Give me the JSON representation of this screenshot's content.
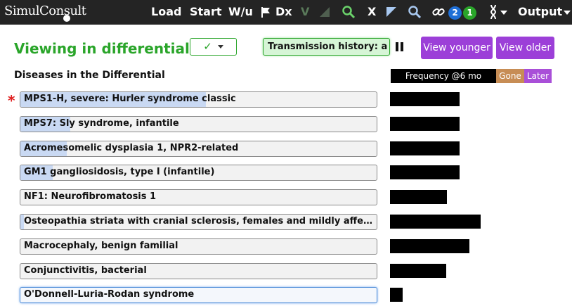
{
  "app": {
    "logo": "SimulConsult",
    "nav": {
      "load": "Load",
      "start": "Start",
      "wu": "W/u",
      "dx": "Dx",
      "v": "V",
      "x": "X",
      "badge_blue": "2",
      "badge_green": "1",
      "output": "Output"
    }
  },
  "colors": {
    "accent_green": "#2aa52a",
    "purple": "#9c3fd8",
    "gone": "#c78d55",
    "later": "#a94fd8"
  },
  "header": {
    "title": "Viewing in differential",
    "check_value": "✓",
    "transmission": "Transmission history: a ...",
    "view_younger": "View younger",
    "view_older": "View older"
  },
  "differential": {
    "heading": "Diseases in the Differential",
    "frequency_label": "Frequency @6 mo",
    "gone_label": "Gone",
    "later_label": "Later",
    "diseases": [
      {
        "name": "MPS1-H, severe: Hurler syndrome classic",
        "starred": true,
        "fill": 0.52,
        "frequency": 0.66
      },
      {
        "name": "MPS7: Sly syndrome, infantile",
        "starred": false,
        "fill": 0.14,
        "frequency": 0.66
      },
      {
        "name": "Acromesomelic dysplasia 1, NPR2-related",
        "starred": false,
        "fill": 0.13,
        "frequency": 0.66
      },
      {
        "name": "GM1 gangliosidosis, type I (infantile)",
        "starred": false,
        "fill": 0.09,
        "frequency": 0.66
      },
      {
        "name": "NF1: Neurofibromatosis 1",
        "starred": false,
        "fill": 0.0,
        "frequency": 0.54
      },
      {
        "name": "Osteopathia striata with cranial sclerosis, females and mildly affected m...",
        "starred": false,
        "fill": 0.01,
        "frequency": 0.86
      },
      {
        "name": "Macrocephaly, benign familial",
        "starred": false,
        "fill": 0.0,
        "frequency": 0.75
      },
      {
        "name": "Conjunctivitis, bacterial",
        "starred": false,
        "fill": 0.0,
        "frequency": 0.53
      },
      {
        "name": "O'Donnell-Luria-Rodan syndrome",
        "starred": false,
        "fill": 0.0,
        "frequency": 0.12,
        "selected": true
      }
    ]
  }
}
